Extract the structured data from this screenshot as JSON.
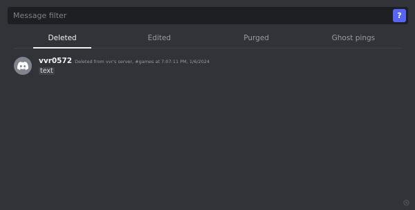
{
  "filter": {
    "placeholder": "Message filter",
    "value": "",
    "help_label": "?"
  },
  "tabs": [
    {
      "label": "Deleted",
      "active": true
    },
    {
      "label": "Edited",
      "active": false
    },
    {
      "label": "Purged",
      "active": false
    },
    {
      "label": "Ghost pings",
      "active": false
    }
  ],
  "message": {
    "username": "vvr0572",
    "meta": "Deleted from vvr's server, #games at 7:07:11 PM, 1/6/2024",
    "text": "text",
    "avatar_icon": "discord-logo-icon"
  },
  "watermark": {
    "icon": "watermark-logo-icon"
  },
  "colors": {
    "background": "#313338",
    "input_background": "#1e1f22",
    "accent": "#5865f2",
    "avatar": "#80848e"
  }
}
